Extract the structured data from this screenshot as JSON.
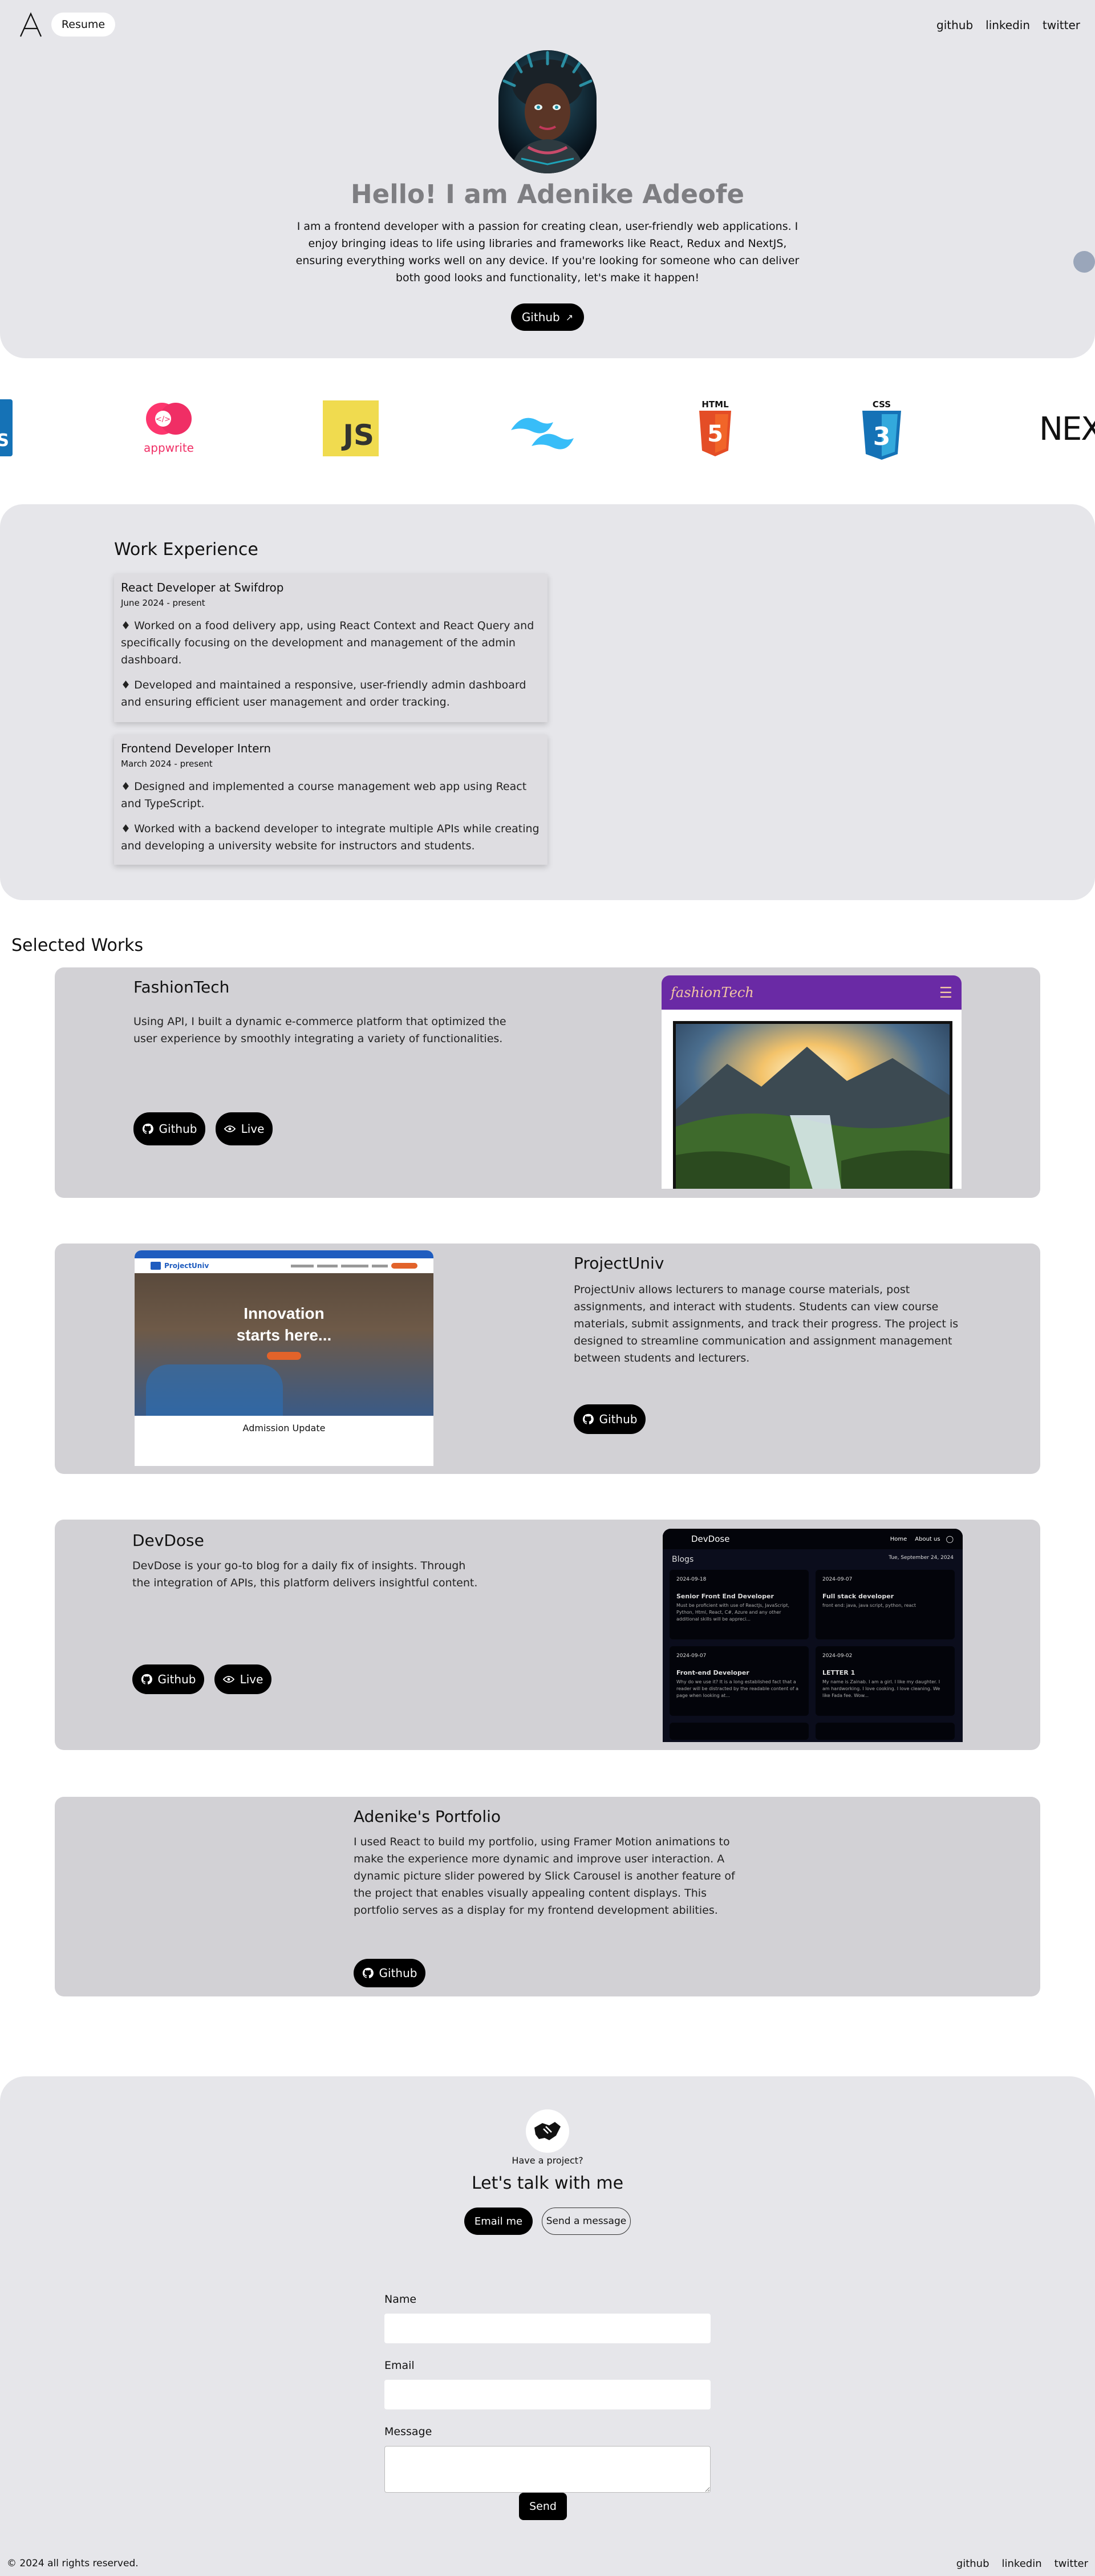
{
  "nav": {
    "resume_label": "Resume",
    "links": [
      "github",
      "linkedin",
      "twitter"
    ]
  },
  "hero": {
    "title": "Hello! I am Adenike Adeofe",
    "intro_lines": [
      "I am a frontend developer with a passion for creating clean, user-friendly web applications. I",
      "enjoy bringing ideas to life using libraries and frameworks like React, Redux and NextJS,",
      "ensuring everything works well on any device. If you're looking for someone who can deliver",
      "both good looks and functionality, let's make it happen!"
    ],
    "github_button": "Github",
    "arrow_icon": "↗"
  },
  "tech_logos": {
    "appwrite_label": "appwrite",
    "js_label": "JS",
    "html_label": "HTML",
    "html_number": "5",
    "css_label": "CSS",
    "css_number": "3",
    "next_label": "NEX"
  },
  "experience": {
    "heading": "Work Experience",
    "jobs": [
      {
        "title": "React Developer at Swifdrop",
        "date": "June 2024 - present",
        "bullets": [
          "♦ Worked on a food delivery app, using React Context and React Query and specifically focusing on the development and management of the admin dashboard.",
          "♦ Developed and maintained a responsive, user-friendly admin dashboard and ensuring efficient user management and order tracking."
        ]
      },
      {
        "title": "Frontend Developer Intern",
        "date": "March 2024 - present",
        "bullets": [
          "♦ Designed and implemented a course management web app using React and TypeScript.",
          "♦ Worked with a backend developer to integrate multiple APIs while creating and developing a university website for instructors and students."
        ]
      }
    ]
  },
  "works": {
    "heading": "Selected Works",
    "projects": [
      {
        "title": "FashionTech",
        "description": "Using API, I built a dynamic e-commerce platform that optimized the user experience by smoothly integrating a variety of functionalities.",
        "github_label": "Github",
        "live_label": "Live",
        "screenshot_brand": "fashionTech"
      },
      {
        "title": "ProjectUniv",
        "description": "ProjectUniv allows lecturers to manage course materials, post assignments, and interact with students. Students can view course materials, submit assignments, and track their progress. The project is designed to streamline communication and assignment management between students and lecturers.",
        "github_label": "Github",
        "screenshot_brand": "ProjectUniv",
        "screenshot_hero_line1": "Innovation",
        "screenshot_hero_line2": "starts here...",
        "screenshot_footer": "Admission Update"
      },
      {
        "title": "DevDose",
        "description": "DevDose is your go-to blog for a daily fix of insights. Through the integration of APIs, this platform delivers insightful content.",
        "github_label": "Github",
        "live_label": "Live",
        "screenshot_brand": "DevDose",
        "screenshot_nav": [
          "Home",
          "About us"
        ],
        "screenshot_section": "Blogs",
        "screenshot_date": "Tue, September 24, 2024",
        "screenshot_cards": [
          {
            "date": "2024-09-18",
            "title": "Senior Front End Developer",
            "text": "Must be proficient with use of ReactJs, JavaScript, Python, Html, React, C#, Azure and any other additional skills will be appreci..."
          },
          {
            "date": "2024-09-07",
            "title": "Full stack developer",
            "text": "front end: java, java script, python, react"
          },
          {
            "date": "2024-09-07",
            "title": "Front-end Developer",
            "text": "Why do we use it? It is a long established fact that a reader will be distracted by the readable content of a page when looking at..."
          },
          {
            "date": "2024-09-02",
            "title": "LETTER 1",
            "text": "My name is Zainab. I am a girl. I like my daughter. I am hardworking. I love cooking. I love cleaning. We like Fada fee. Wow..."
          }
        ]
      },
      {
        "title": "Adenike's Portfolio",
        "description": "I used React to build my portfolio, using Framer Motion animations to make the experience more dynamic and improve user interaction. A dynamic picture slider powered by Slick Carousel is another feature of the project that enables visually appealing content displays. This portfolio serves as a display for my frontend development abilities.",
        "github_label": "Github"
      }
    ]
  },
  "contact": {
    "have_project": "Have a project?",
    "heading": "Let's talk with me",
    "email_button": "Email me",
    "message_button": "Send a message",
    "name_label": "Name",
    "email_label": "Email",
    "message_label": "Message",
    "name_value": "",
    "email_value": "",
    "message_value": "",
    "send_button": "Send"
  },
  "footer": {
    "copyright": "© 2024 all rights reserved.",
    "links": [
      "github",
      "linkedin",
      "twitter"
    ]
  },
  "colors": {
    "page_gray": "#e6e6ea",
    "card_gray": "#d2d1d5",
    "appwrite_pink": "#f02e65",
    "js_yellow": "#f0db4f",
    "tailwind_cyan": "#38bdf8",
    "html_orange": "#e44d26",
    "css_blue": "#1572b6",
    "fashion_purple": "#6a2aa5",
    "univ_blue": "#1f5cbf",
    "devdose_dark": "#0b0d1c"
  }
}
